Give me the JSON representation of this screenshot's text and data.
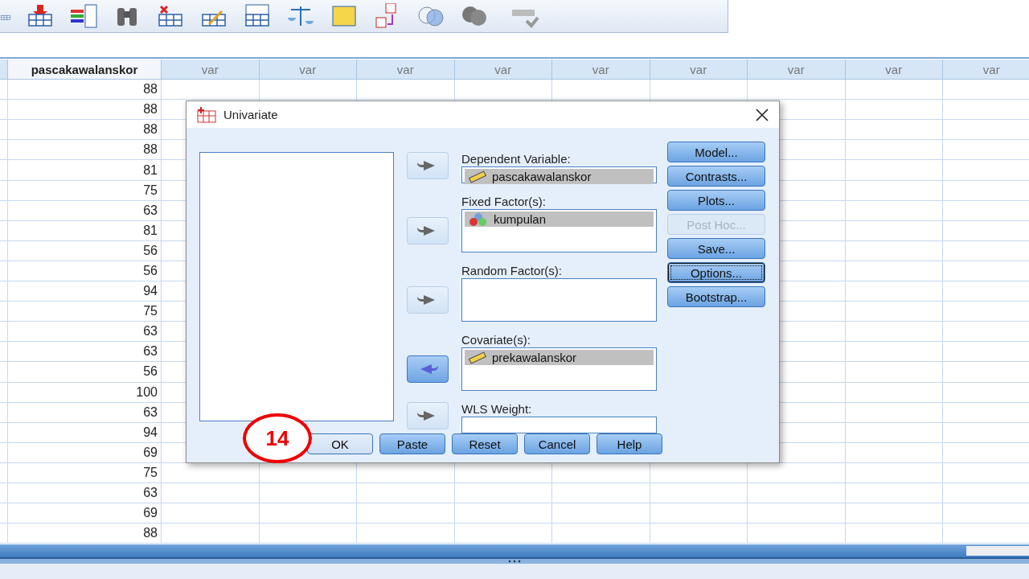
{
  "grid": {
    "columns": [
      {
        "label": "pascakawalanskor",
        "kind": "variable"
      },
      {
        "label": "var",
        "kind": "empty"
      },
      {
        "label": "var",
        "kind": "empty"
      },
      {
        "label": "var",
        "kind": "empty"
      },
      {
        "label": "var",
        "kind": "empty"
      },
      {
        "label": "var",
        "kind": "empty"
      },
      {
        "label": "var",
        "kind": "empty"
      },
      {
        "label": "var",
        "kind": "empty"
      },
      {
        "label": "var",
        "kind": "empty"
      },
      {
        "label": "var",
        "kind": "empty"
      }
    ],
    "rows": [
      "88",
      "88",
      "88",
      "88",
      "81",
      "75",
      "63",
      "81",
      "56",
      "56",
      "94",
      "75",
      "63",
      "63",
      "56",
      "100",
      "63",
      "94",
      "69",
      "75",
      "63",
      "69",
      "88"
    ]
  },
  "dialog": {
    "title": "Univariate",
    "targets": [
      {
        "label": "Dependent Variable:",
        "kind": "single",
        "arrow": {
          "active": false
        },
        "items": [
          {
            "name": "pascakawalanskor",
            "kind": "scale"
          }
        ]
      },
      {
        "label": "Fixed Factor(s):",
        "kind": "list",
        "arrow": {
          "active": false
        },
        "items": [
          {
            "name": "kumpulan",
            "kind": "nominal"
          }
        ]
      },
      {
        "label": "Random Factor(s):",
        "kind": "list",
        "arrow": {
          "active": false
        }
      },
      {
        "label": "Covariate(s):",
        "kind": "list",
        "arrow": {
          "active": true
        },
        "items": [
          {
            "name": "prekawalanskor",
            "kind": "scale"
          }
        ]
      },
      {
        "label": "WLS Weight:",
        "kind": "single",
        "arrow": {
          "active": false
        }
      }
    ],
    "side_buttons": [
      {
        "label": "Model...",
        "disabled": false,
        "focused": false
      },
      {
        "label": "Contrasts...",
        "disabled": false,
        "focused": false
      },
      {
        "label": "Plots...",
        "disabled": false,
        "focused": false
      },
      {
        "label": "Post Hoc...",
        "disabled": true,
        "focused": false
      },
      {
        "label": "Save...",
        "disabled": false,
        "focused": false
      },
      {
        "label": "Options...",
        "disabled": false,
        "focused": true
      },
      {
        "label": "Bootstrap...",
        "disabled": false,
        "focused": false
      }
    ],
    "buttons": [
      "OK",
      "Paste",
      "Reset",
      "Cancel",
      "Help"
    ]
  },
  "callout": {
    "label": "14"
  }
}
